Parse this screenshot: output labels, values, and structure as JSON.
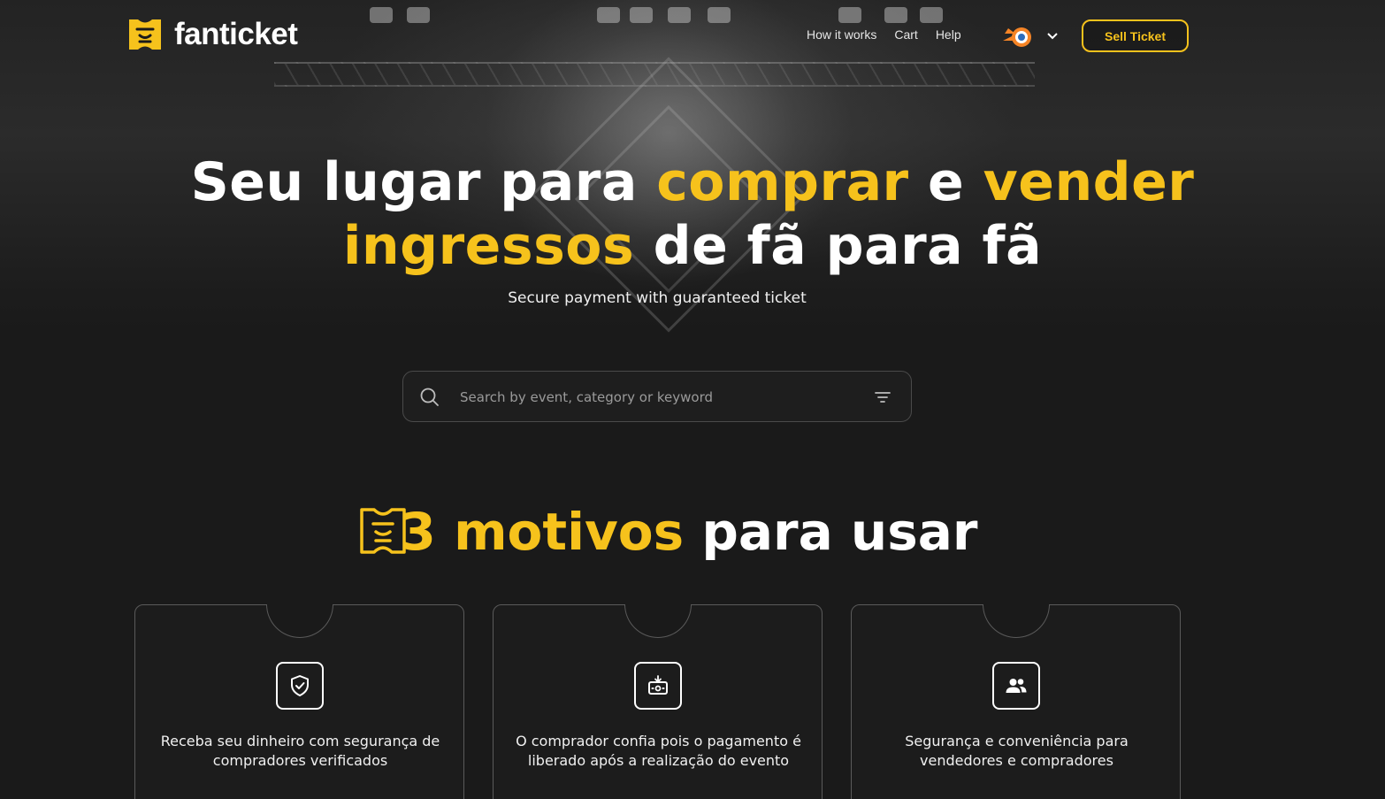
{
  "header": {
    "brand": "fanticket",
    "nav": [
      "How it works",
      "Cart",
      "Help"
    ],
    "sell_button": "Sell Ticket"
  },
  "hero": {
    "line1": {
      "part1": "Seu lugar para ",
      "part2": "comprar",
      "part3": " e ",
      "part4": "vender"
    },
    "line2": {
      "part1": "ingressos",
      "part2": " de fã para fã"
    },
    "subtitle": "Secure payment with guaranteed ticket"
  },
  "search": {
    "placeholder": "Search by event, category or keyword"
  },
  "section": {
    "title_highlight": "3 motivos",
    "title_rest": " para usar"
  },
  "cards": [
    {
      "icon": "shield-check-icon",
      "text": "Receba seu dinheiro com segurança de compradores verificados"
    },
    {
      "icon": "payment-release-icon",
      "text": "O comprador confia pois o pagamento é liberado após a realização do evento"
    },
    {
      "icon": "users-icon",
      "text": "Segurança e conveniência para vendedores e compradores"
    }
  ],
  "colors": {
    "accent": "#f6c21c",
    "background": "#1a1a1a"
  }
}
